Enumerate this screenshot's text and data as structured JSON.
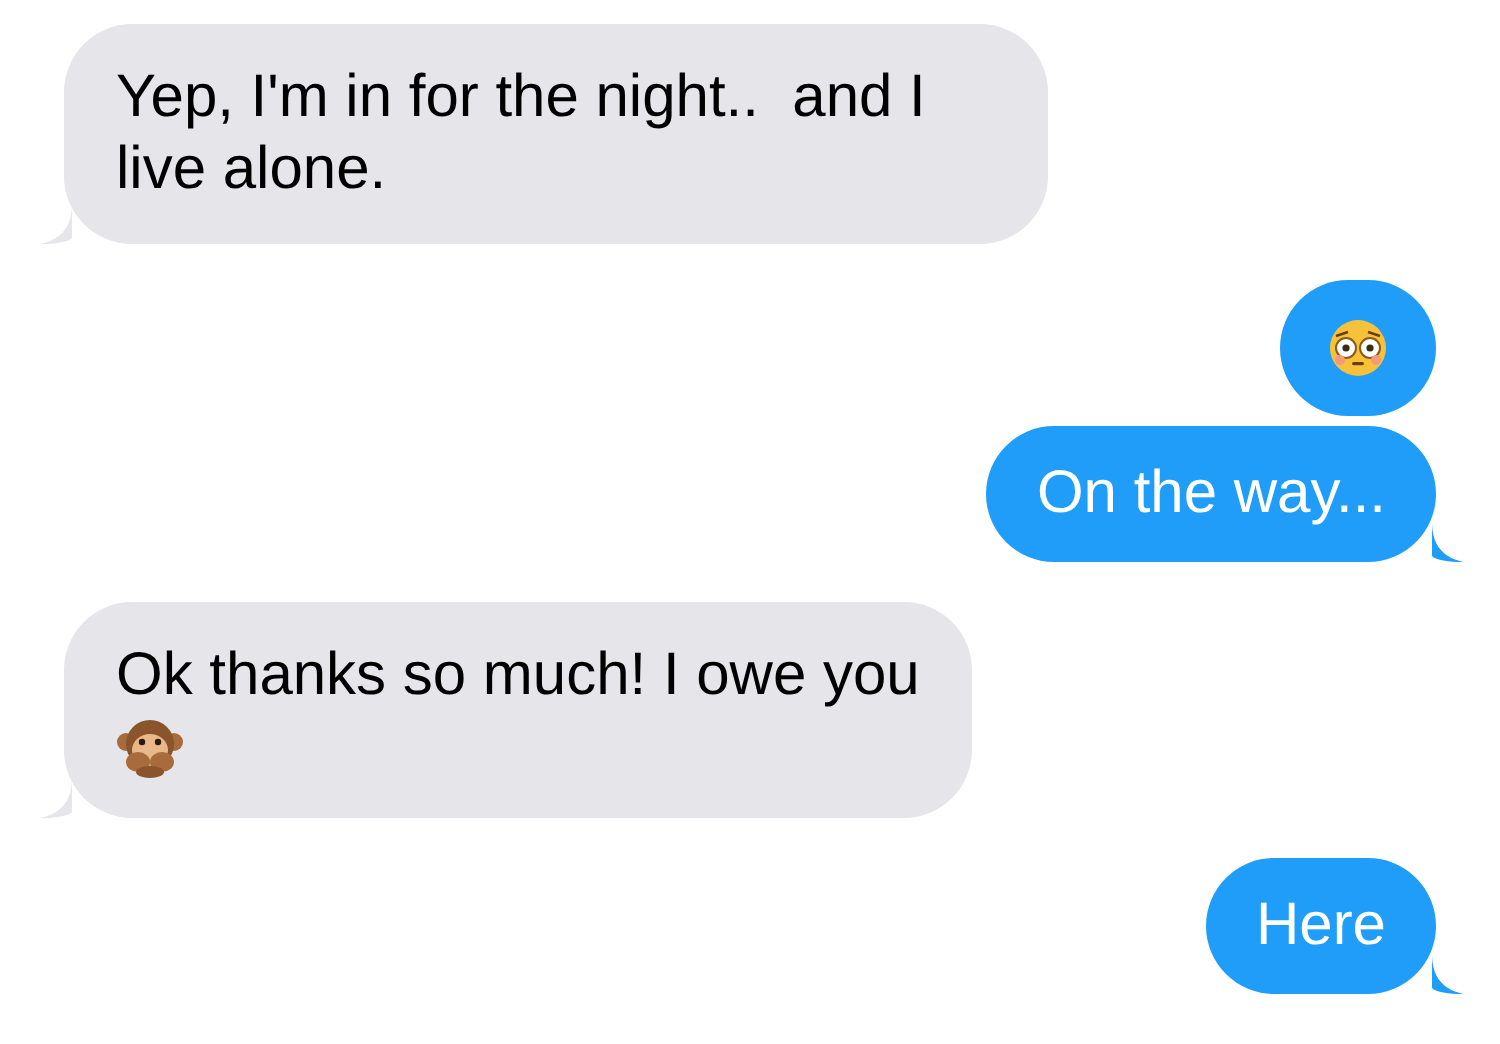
{
  "messages": [
    {
      "outgoing": false,
      "kind": "text",
      "text": "Yep, I'm in for the night..  and I live alone."
    },
    {
      "outgoing": true,
      "kind": "emoji_face"
    },
    {
      "outgoing": true,
      "kind": "text",
      "text": "On the way..."
    },
    {
      "outgoing": false,
      "kind": "text_monkey",
      "text": "Ok thanks so much! I owe you"
    },
    {
      "outgoing": true,
      "kind": "text",
      "text": "Here"
    }
  ]
}
